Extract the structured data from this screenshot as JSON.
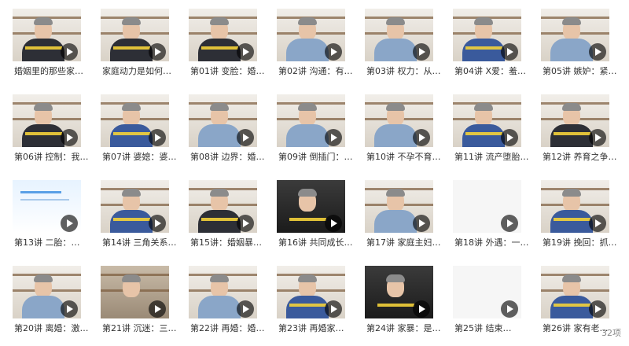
{
  "footer": {
    "item_count": "32项"
  },
  "items": [
    {
      "label": "婚姻里的那些家…",
      "style": "dark"
    },
    {
      "label": "家庭动力是如何…",
      "style": "dark"
    },
    {
      "label": "第01讲 变脸：婚…",
      "style": "dark"
    },
    {
      "label": "第02讲 沟通：有…",
      "style": "light"
    },
    {
      "label": "第03讲 权力：从…",
      "style": "light"
    },
    {
      "label": "第04讲 X爱：羞…",
      "style": "blue"
    },
    {
      "label": "第05讲 嫉妒：紧…",
      "style": "light"
    },
    {
      "label": "第06讲 控制：我…",
      "style": "dark"
    },
    {
      "label": "第07讲 婆媳：婆…",
      "style": "blue"
    },
    {
      "label": "第08讲 边界：婚…",
      "style": "light"
    },
    {
      "label": "第09讲 倒插门：…",
      "style": "light"
    },
    {
      "label": "第10讲 不孕不育…",
      "style": "light"
    },
    {
      "label": "第11讲 流产堕胎…",
      "style": "blue"
    },
    {
      "label": "第12讲 养育之争…",
      "style": "dark"
    },
    {
      "label": "第13讲 二胎：…",
      "style": "slide"
    },
    {
      "label": "第14讲 三角关系…",
      "style": "blue"
    },
    {
      "label": "第15讲：婚姻暴…",
      "style": "dark"
    },
    {
      "label": "第16讲 共同成长…",
      "style": "darkbg"
    },
    {
      "label": "第17讲 家庭主妇…",
      "style": "light"
    },
    {
      "label": "第18讲 外遇：一…",
      "style": "white"
    },
    {
      "label": "第19讲 挽回：抓…",
      "style": "blue"
    },
    {
      "label": "第20讲 离婚：激…",
      "style": "light"
    },
    {
      "label": "第21讲 沉迷：三…",
      "style": "room"
    },
    {
      "label": "第22讲 再婚：婚…",
      "style": "light"
    },
    {
      "label": "第23讲 再婚家…",
      "style": "blue"
    },
    {
      "label": "第24讲 家暴：是…",
      "style": "darkbg"
    },
    {
      "label": "第25讲 结束…",
      "style": "white"
    },
    {
      "label": "第26讲 家有老…",
      "style": "blue"
    }
  ]
}
